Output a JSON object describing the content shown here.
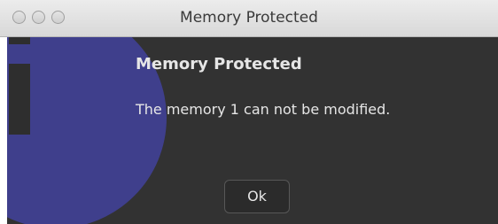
{
  "window": {
    "title": "Memory Protected"
  },
  "dialog": {
    "icon": "info-icon",
    "heading": "Memory Protected",
    "message": "The memory 1 can not be modified.",
    "ok_label": "Ok"
  },
  "colors": {
    "content_background": "#323232",
    "icon_accent": "#3f3f8c",
    "text": "#e6e6e6"
  }
}
